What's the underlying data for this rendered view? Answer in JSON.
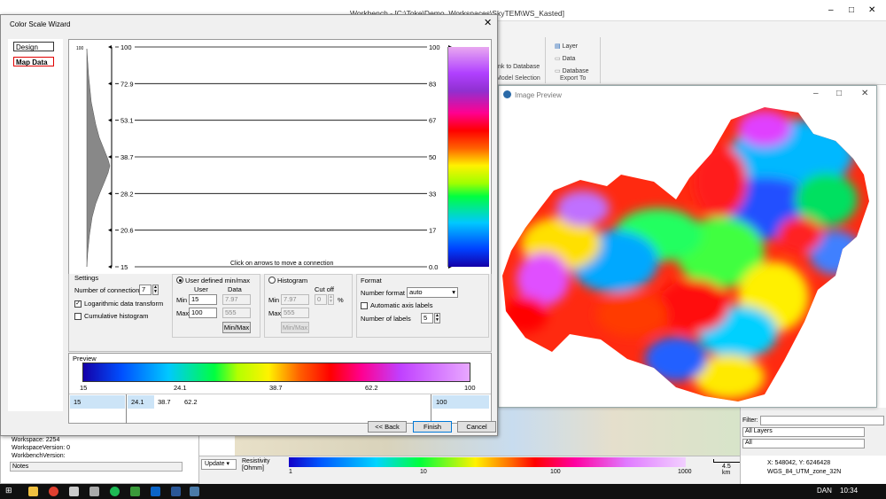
{
  "main_window": {
    "title": "Workbench - [C:\\Toke\\Demo_Workspaces\\SkyTEM\\WS_Kasted]",
    "controls": [
      "–",
      "□",
      "✕"
    ]
  },
  "ribbon": {
    "items": [
      "Layer",
      "Data",
      "Database"
    ],
    "link_to_database": "nk to Database",
    "model_selection": "Model Selection",
    "export_to": "Export To"
  },
  "image_preview": {
    "title": "Image Preview",
    "controls": [
      "–",
      "□",
      "✕"
    ]
  },
  "dialog": {
    "title": "Color Scale Wizard",
    "nav": [
      {
        "label": "Design"
      },
      {
        "label": "Map Data"
      }
    ],
    "chart": {
      "hint": "Click on arrows to move a connection",
      "histogram_top_label": "100",
      "left_labels": [
        "100",
        "72.9",
        "53.1",
        "38.7",
        "28.2",
        "20.6",
        "15"
      ],
      "right_labels": [
        "100",
        "83",
        "67",
        "50",
        "33",
        "17",
        "0.0"
      ]
    },
    "settings": {
      "title": "Settings",
      "num_connections_label": "Number of connections",
      "num_connections": "7",
      "log_transform_label": "Logarithmic data transform",
      "log_transform_checked": true,
      "cumulative_label": "Cumulative histogram",
      "cumulative_checked": false
    },
    "user_defined": {
      "title": "User defined min/max",
      "col_user": "User",
      "col_data": "Data",
      "min_label": "Min",
      "max_label": "Max",
      "min_user": "15",
      "min_data": "7.97",
      "max_user": "100",
      "max_data": "555",
      "minmax_button": "Min/Max",
      "selected": true
    },
    "histogram_group": {
      "title": "Histogram",
      "cutoff_label": "Cut off",
      "min_label": "Min",
      "max_label": "Max",
      "min_value": "7.97",
      "max_value": "555",
      "cutoff_value": "0",
      "percent": "%",
      "minmax_button": "Min/Max",
      "selected": false
    },
    "format": {
      "title": "Format",
      "number_format_label": "Number format",
      "number_format": "auto",
      "auto_axis_label": "Automatic axis labels",
      "auto_axis_checked": false,
      "num_labels_label": "Number of labels",
      "num_labels": "5"
    },
    "preview": {
      "title": "Preview",
      "tick_labels": [
        "15",
        "24.1",
        "38.7",
        "62.2",
        "100"
      ],
      "row": [
        "15",
        "24.1",
        "38.7",
        "62.2",
        "100"
      ]
    },
    "buttons": {
      "back": "<< Back",
      "finish": "Finish",
      "cancel": "Cancel"
    }
  },
  "left_panel": {
    "workspace": "Workspace:  2254",
    "workspace_version": "WorkspaceVersion:  0",
    "workbench_version": "WorkbenchVersion:",
    "notes": "Notes"
  },
  "legend": {
    "update_label": "Update",
    "title": "Resistivity",
    "unit": "[Ohmm]",
    "ticks": [
      "1",
      "10",
      "100",
      "1000"
    ]
  },
  "scale": {
    "label": "4.5 km"
  },
  "coords": {
    "xy": "X: 548042, Y: 6246428",
    "crs": "WGS_84_UTM_zone_32N"
  },
  "right_panel": {
    "filter_label": "Filter:",
    "all_layers": "All Layers",
    "all": "All"
  },
  "taskbar": {
    "language": "DAN",
    "time": "10:34"
  },
  "colors": {
    "dialog_bg": "#f0f0f0",
    "selection_blue": "#cce4f7",
    "nav_selected_border": "#e00000"
  }
}
